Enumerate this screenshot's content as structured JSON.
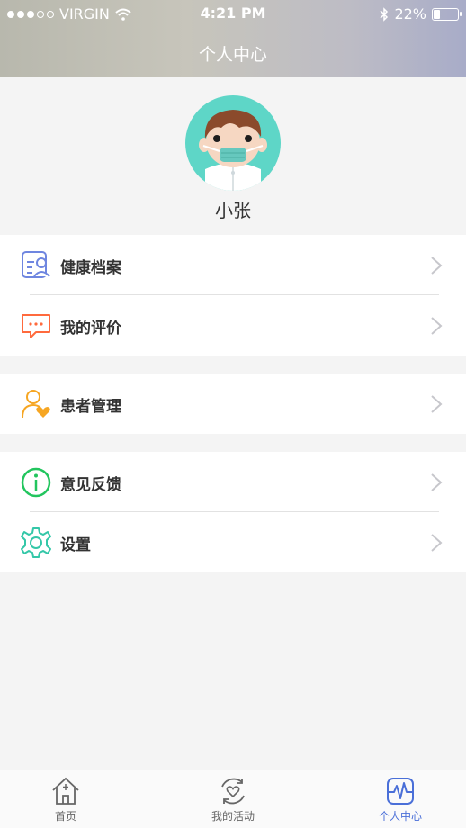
{
  "status_bar": {
    "carrier": "VIRGIN",
    "time": "4:21 PM",
    "battery": "22%",
    "battery_level": 0.22
  },
  "header": {
    "title": "个人中心"
  },
  "profile": {
    "name": "小张"
  },
  "menu": {
    "health_records": "健康档案",
    "my_reviews": "我的评价",
    "patient_management": "患者管理",
    "feedback": "意见反馈",
    "settings": "设置"
  },
  "tabs": {
    "home": "首页",
    "my_activities": "我的活动",
    "personal_center": "个人中心"
  },
  "colors": {
    "accent": "#4a6fd8",
    "health_icon": "#6f86e0",
    "review_icon": "#ff6a3d",
    "patient_icon": "#f6a623",
    "feedback_icon": "#22c55e",
    "settings_icon": "#34c7a8",
    "avatar_bg": "#5ed6c7"
  }
}
